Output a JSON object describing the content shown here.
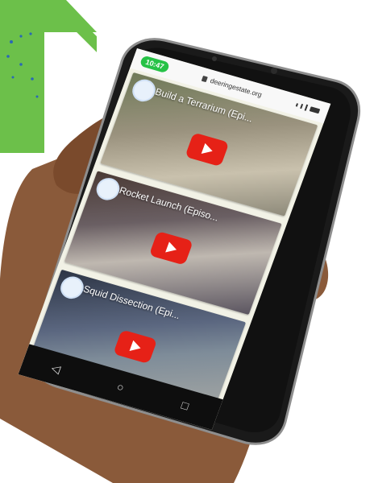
{
  "phone": {
    "status": {
      "time": "10:47",
      "url": "deeringestate.org"
    },
    "videos": [
      {
        "title": "Build a Terrarium (Epi...",
        "icon": "youtube-play-icon"
      },
      {
        "title": "Rocket Launch (Episo...",
        "icon": "youtube-play-icon"
      },
      {
        "title": "Squid Dissection (Epi...",
        "icon": "youtube-play-icon"
      }
    ],
    "nav": {
      "back_icon": "back-triangle-icon",
      "home_icon": "home-circle-icon",
      "recent_icon": "recent-square-icon"
    }
  },
  "colors": {
    "brand_green": "#6cc04a",
    "youtube_red": "#e62117",
    "status_green": "#26c246"
  }
}
